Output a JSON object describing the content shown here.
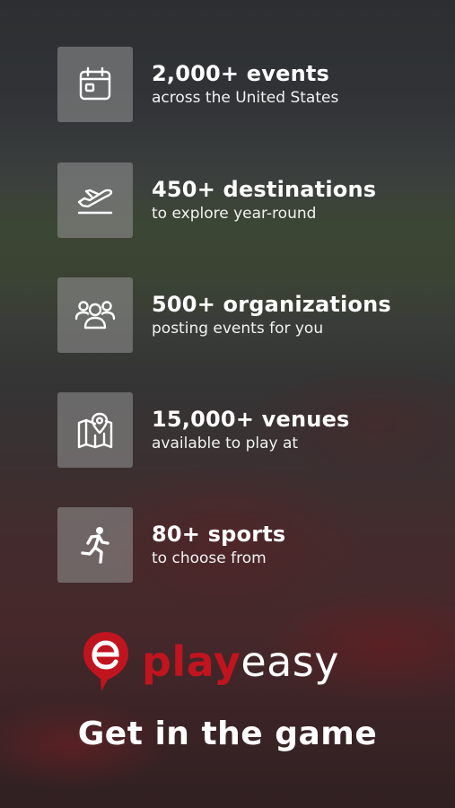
{
  "features": [
    {
      "title": "2,000+ events",
      "subtitle": "across the United States",
      "icon": "calendar-icon"
    },
    {
      "title": "450+ destinations",
      "subtitle": "to explore year-round",
      "icon": "airplane-icon"
    },
    {
      "title": "500+ organizations",
      "subtitle": "posting events for you",
      "icon": "people-icon"
    },
    {
      "title": "15,000+ venues",
      "subtitle": "available to play at",
      "icon": "map-icon"
    },
    {
      "title": "80+ sports",
      "subtitle": "to choose from",
      "icon": "running-icon"
    }
  ],
  "logo": {
    "play": "play",
    "easy": "easy",
    "mark_letter": "e"
  },
  "tagline": "Get in the game",
  "colors": {
    "brand_red": "#c0141f",
    "icon_box": "#969696",
    "text": "#ffffff"
  }
}
